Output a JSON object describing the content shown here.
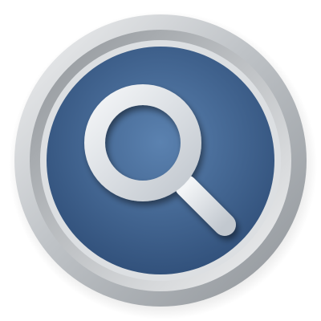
{
  "icon": {
    "name": "search-icon",
    "symbol": "magnifying-glass-icon",
    "colors": {
      "background": "#ffffff",
      "bezel_light": "#f2f3f4",
      "bezel_mid": "#bfc3c7",
      "bezel_dark": "#8e9398",
      "inner_shadow_ring": "#dcdfe2",
      "face_center": "#5b82b0",
      "face_edge": "#2f4e78",
      "glyph_light": "#f3f5f7",
      "glyph_dark": "#c2c8cf"
    }
  }
}
